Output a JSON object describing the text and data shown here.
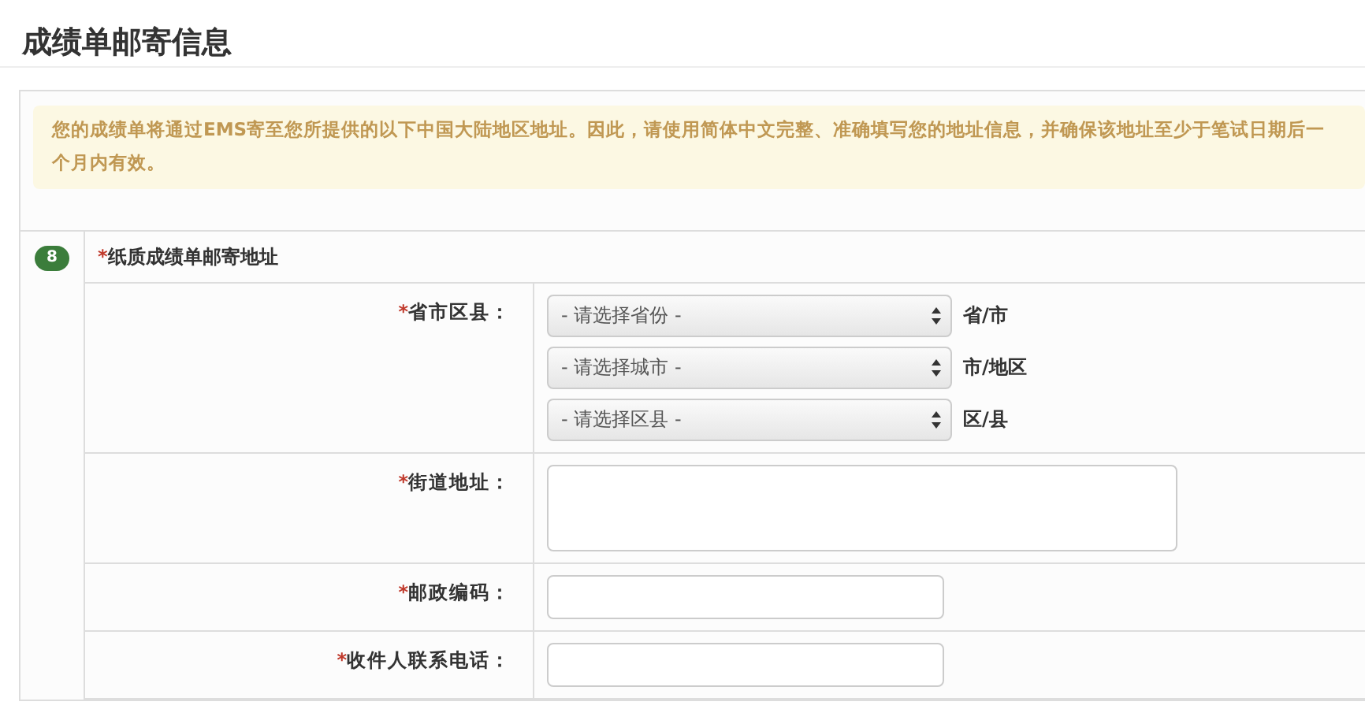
{
  "page_title": "成绩单邮寄信息",
  "notice": "您的成绩单将通过EMS寄至您所提供的以下中国大陆地区地址。因此，请使用简体中文完整、准确填写您的地址信息，并确保该地址至少于笔试日期后一个月内有效。",
  "section": {
    "number": "8",
    "required_mark": "*",
    "title": "纸质成绩单邮寄地址"
  },
  "fields": [
    {
      "kind": "selects",
      "required_mark": "*",
      "label": "省市区县：",
      "selects": [
        {
          "value": "- 请选择省份 -",
          "suffix": "省/市"
        },
        {
          "value": "- 请选择城市 -",
          "suffix": "市/地区"
        },
        {
          "value": "- 请选择区县 -",
          "suffix": "区/县"
        }
      ]
    },
    {
      "kind": "textarea",
      "required_mark": "*",
      "label": "街道地址："
    },
    {
      "kind": "input",
      "required_mark": "*",
      "label": "邮政编码："
    },
    {
      "kind": "input",
      "required_mark": "*",
      "label": "收件人联系电话："
    }
  ]
}
